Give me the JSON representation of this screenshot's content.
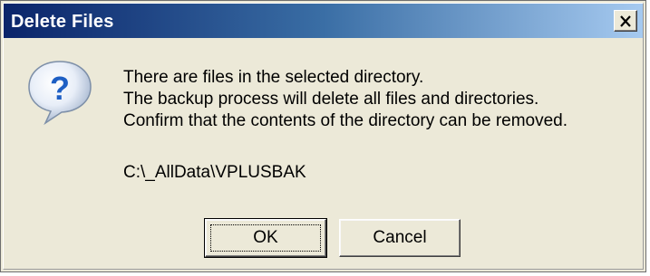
{
  "window": {
    "title": "Delete Files",
    "close_label": "X"
  },
  "icon": "question-icon",
  "message": {
    "line1": "There are files in the selected directory.",
    "line2": "The backup process will delete all files and directories.",
    "line3": "Confirm that the contents of the directory can be removed."
  },
  "path": "C:\\_AllData\\VPLUSBAK",
  "buttons": {
    "ok_label": "OK",
    "cancel_label": "Cancel"
  },
  "colors": {
    "titlebar_start": "#0a246a",
    "titlebar_end": "#a6caf0",
    "dialog_bg": "#ece9d8",
    "icon_blue": "#1e5fc4"
  }
}
